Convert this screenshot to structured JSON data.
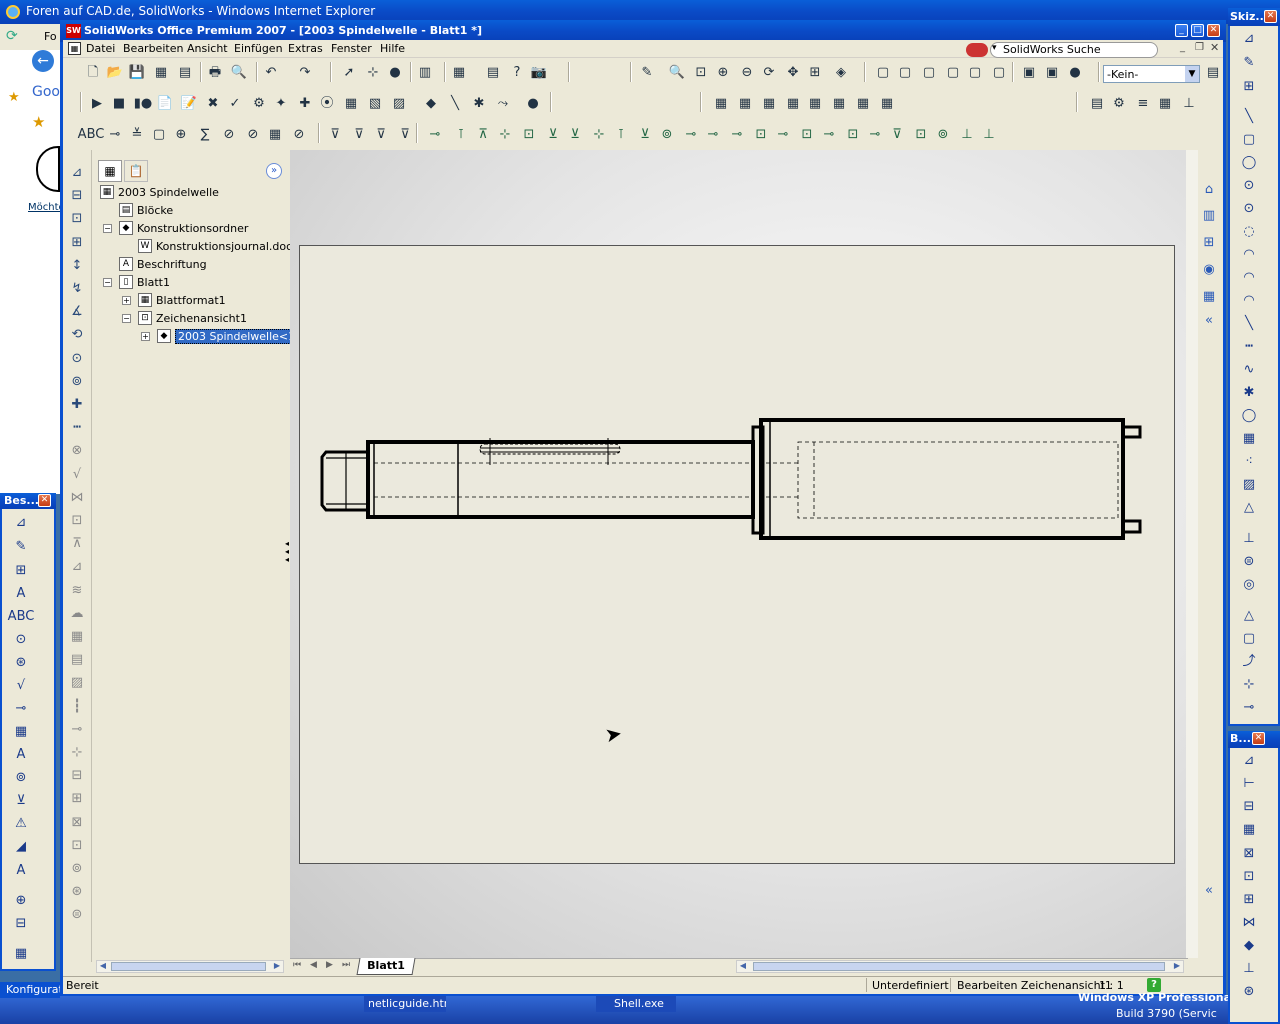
{
  "ie": {
    "title": "Foren auf CAD.de, SolidWorks - Windows Internet Explorer",
    "tab_label": "Fo",
    "google_label": "Goo",
    "partial_link": "Möchte"
  },
  "app": {
    "title": "SolidWorks Office Premium 2007 - [2003 Spindelwelle - Blatt1 *]",
    "menu": [
      "Datei",
      "Bearbeiten",
      "Ansicht",
      "Einfügen",
      "Extras",
      "Fenster",
      "Hilfe"
    ],
    "search_label": "SolidWorks Suche",
    "layer_select": "-Kein-"
  },
  "tree": {
    "root": "2003 Spindelwelle",
    "items": [
      {
        "label": "Blöcke",
        "icon": "blocks-icon"
      },
      {
        "label": "Konstruktionsordner",
        "icon": "design-folder-icon"
      },
      {
        "label": "Konstruktionsjournal.doc",
        "icon": "word-doc-icon"
      },
      {
        "label": "Beschriftung",
        "icon": "annotation-icon"
      },
      {
        "label": "Blatt1",
        "icon": "sheet-icon"
      },
      {
        "label": "Blattformat1",
        "icon": "sheet-format-icon"
      },
      {
        "label": "Zeichenansicht1",
        "icon": "drawing-view-icon"
      },
      {
        "label": "2003 Spindelwelle<1>",
        "icon": "part-icon"
      }
    ]
  },
  "sheet_tab": "Blatt1",
  "status": {
    "left": "Bereit",
    "state": "Unterdefiniert",
    "editing": "Bearbeiten Zeichenansicht1",
    "scale": "1 : 1",
    "help_icon": "?"
  },
  "left_palette": {
    "title": "Bes..."
  },
  "right_palette_top": {
    "title": "Skiz..."
  },
  "right_palette_bottom": {
    "title": "B..."
  },
  "taskbar": {
    "config_label": "Konfigurat",
    "item1": "netlicguide.htm",
    "item2": "Shell.exe",
    "os_text": "Windows XP Professional x6",
    "build_text": "Build 3790 (Servic"
  }
}
